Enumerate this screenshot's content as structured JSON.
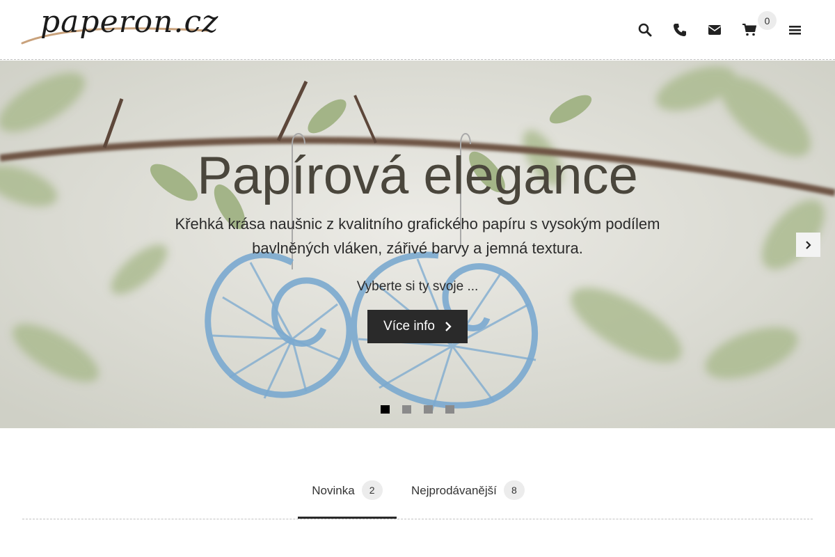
{
  "header": {
    "logo_text": "paperon.cz",
    "icons": [
      "search-icon",
      "phone-icon",
      "mail-icon",
      "cart-icon",
      "menu-icon"
    ],
    "cart_count": "0"
  },
  "hero": {
    "title": "Papírová elegance",
    "subtitle": "Křehká krása naušnic z kvalitního grafického papíru s vysokým podílem bavlněných vláken, zářivé barvy a jemná textura.",
    "tagline": "Vyberte si ty svoje ...",
    "button_label": "Více info",
    "slides_count": 4,
    "active_slide": 1
  },
  "tabs": [
    {
      "label": "Novinka",
      "count": "2",
      "active": true
    },
    {
      "label": "Nejprodávanější",
      "count": "8",
      "active": false
    }
  ],
  "colors": {
    "accent_dark": "#2a2a2a",
    "hero_title": "#4a463c",
    "logo_swash": "#c9a27c",
    "earring_blue": "#7aa9cf"
  }
}
